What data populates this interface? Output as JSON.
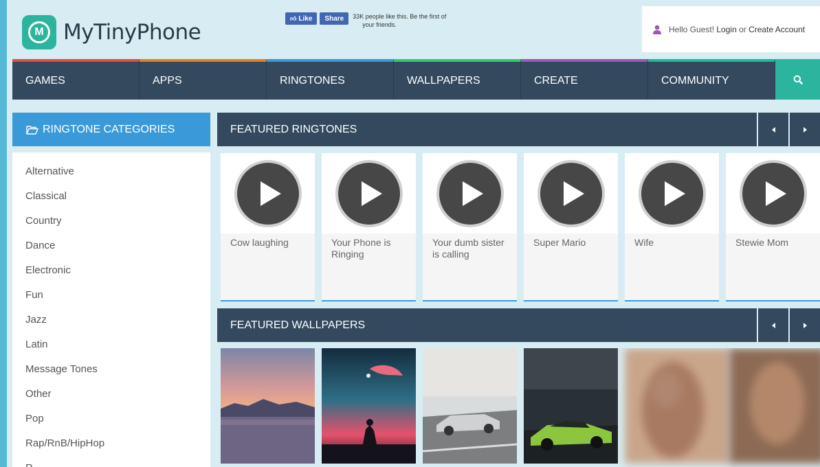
{
  "brand": {
    "logo_letter": "M",
    "name": "MyTinyPhone"
  },
  "facebook": {
    "like_label": "Like",
    "share_label": "Share",
    "text_line1": "33K people like this. Be the first of",
    "text_line2": "your friends."
  },
  "account": {
    "greeting": "Hello Guest!",
    "login": "Login",
    "or": " or ",
    "create": "Create Account"
  },
  "nav": {
    "items": [
      {
        "label": "GAMES",
        "color": "#e74c3c"
      },
      {
        "label": "APPS",
        "color": "#e67e22"
      },
      {
        "label": "RINGTONES",
        "color": "#3a9ad9"
      },
      {
        "label": "WALLPAPERS",
        "color": "#2ecc71"
      },
      {
        "label": "CREATE",
        "color": "#9b59b6"
      },
      {
        "label": "COMMUNITY",
        "color": "#1abc9c"
      }
    ],
    "search_icon": "search-icon"
  },
  "sidebar": {
    "title": "RINGTONE CATEGORIES",
    "items": [
      "Alternative",
      "Classical",
      "Country",
      "Dance",
      "Electronic",
      "Fun",
      "Jazz",
      "Latin",
      "Message Tones",
      "Other",
      "Pop",
      "Rap/RnB/HipHop",
      "R..."
    ]
  },
  "featured_ringtones": {
    "title": "FEATURED RINGTONES",
    "items": [
      "Cow laughing",
      "Your Phone is Ringing",
      "Your dumb sister is calling",
      "Super Mario",
      "Wife",
      "Stewie Mom"
    ]
  },
  "featured_wallpapers": {
    "title": "FEATURED WALLPAPERS"
  },
  "colors": {
    "nav_bg": "#34495e",
    "accent_blue": "#3a9ad9",
    "accent_teal": "#2cb59e",
    "page_bg": "#d7edf3"
  }
}
